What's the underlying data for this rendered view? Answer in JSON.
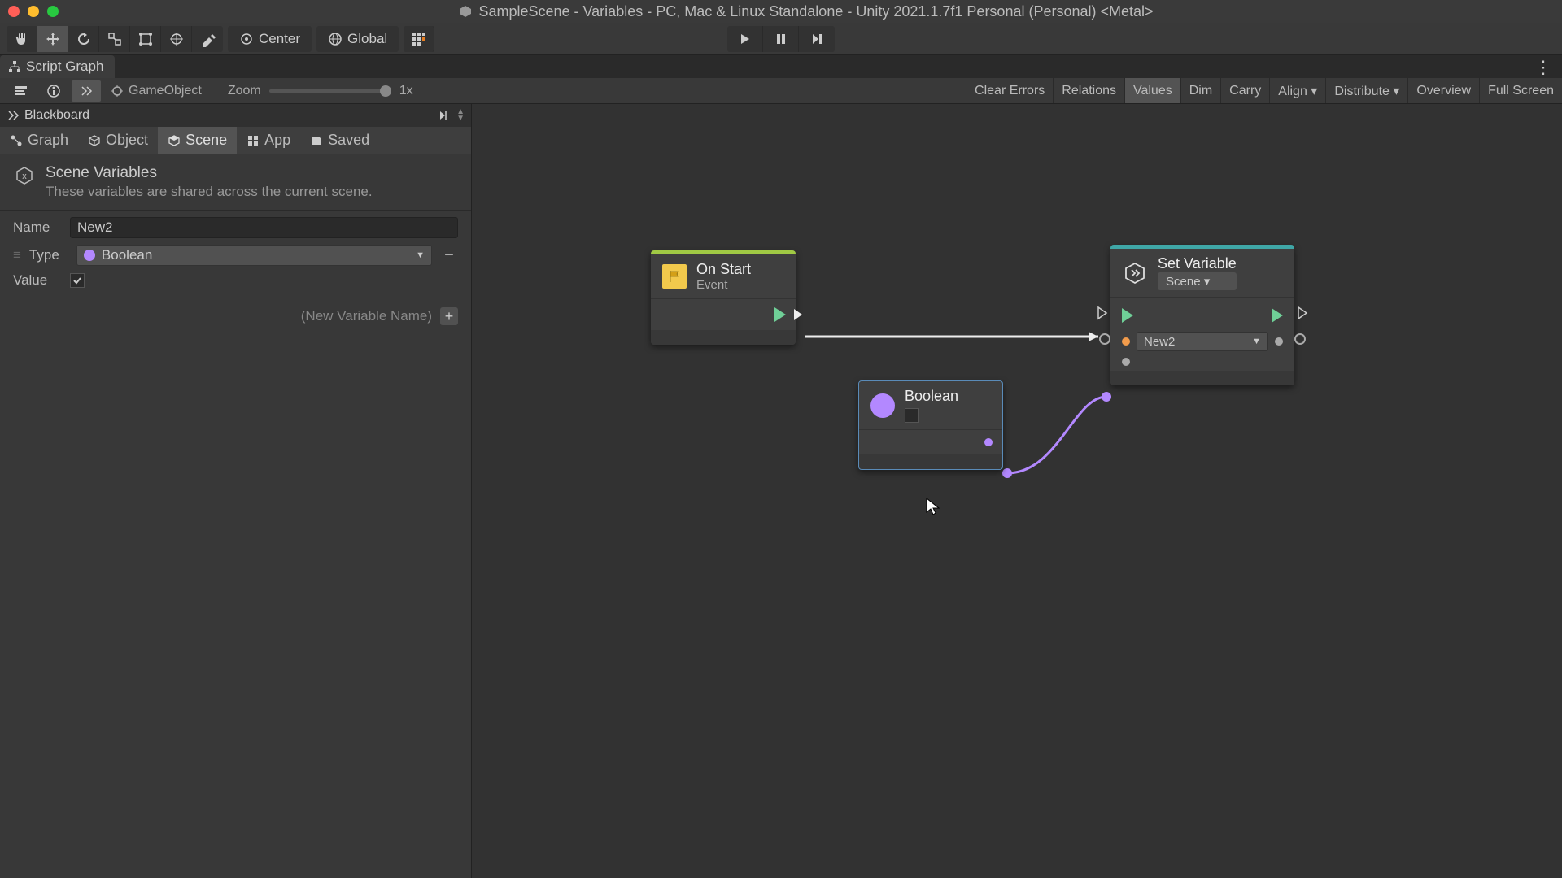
{
  "window_title": "SampleScene - Variables - PC, Mac & Linux Standalone - Unity 2021.1.7f1 Personal (Personal) <Metal>",
  "pivot": {
    "center": "Center",
    "global": "Global"
  },
  "tab": {
    "label": "Script Graph"
  },
  "graph_toolbar": {
    "gameobject": "GameObject",
    "zoom_label": "Zoom",
    "zoom_value": "1x",
    "right_buttons": [
      "Clear Errors",
      "Relations",
      "Values",
      "Dim",
      "Carry",
      "Align ▾",
      "Distribute ▾",
      "Overview",
      "Full Screen"
    ]
  },
  "blackboard": {
    "title": "Blackboard",
    "tabs": [
      "Graph",
      "Object",
      "Scene",
      "App",
      "Saved"
    ],
    "section_title": "Scene Variables",
    "section_desc": "These variables are shared across the current scene.",
    "fields": {
      "name_label": "Name",
      "name_value": "New2",
      "type_label": "Type",
      "type_value": "Boolean",
      "value_label": "Value",
      "value_checked": true
    },
    "new_var_placeholder": "(New Variable Name)"
  },
  "nodes": {
    "onstart": {
      "title": "On Start",
      "subtitle": "Event"
    },
    "boolean": {
      "title": "Boolean"
    },
    "setvar": {
      "title": "Set Variable",
      "scope": "Scene ▾",
      "var_name": "New2"
    }
  }
}
